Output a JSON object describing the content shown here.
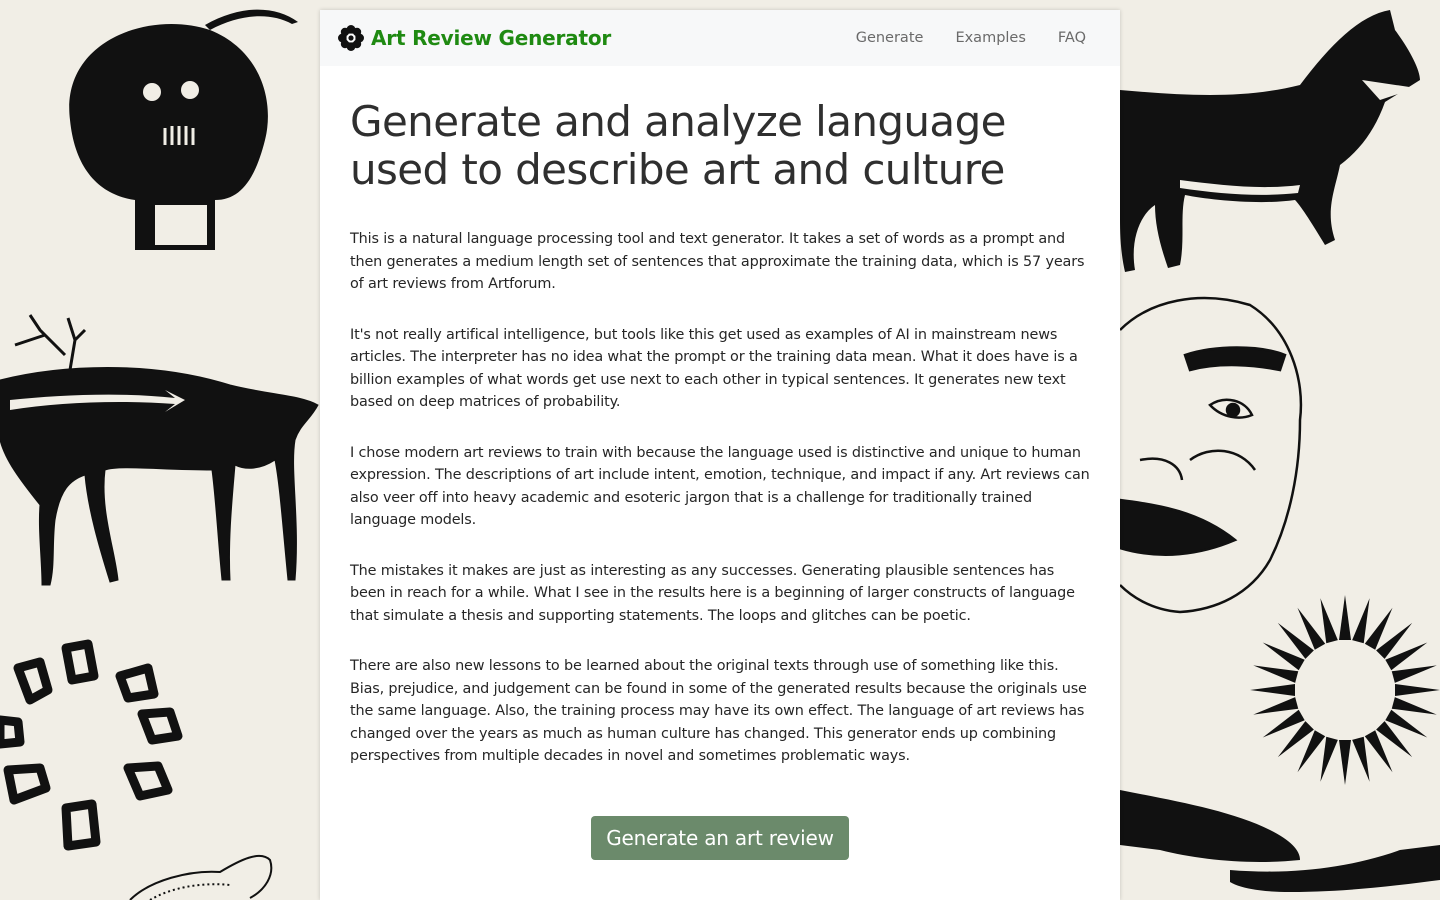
{
  "brand": {
    "title": "Art Review Generator",
    "logo_icon": "flower-logo-icon",
    "color": "#1f8a12"
  },
  "nav": {
    "items": [
      {
        "label": "Generate"
      },
      {
        "label": "Examples"
      },
      {
        "label": "FAQ"
      }
    ]
  },
  "main": {
    "heading": "Generate and analyze language used to describe art and culture",
    "paragraphs": [
      "This is a natural language processing tool and text generator. It takes a set of words as a prompt and then generates a medium length set of sentences that approximate the training data, which is 57 years of art reviews from Artforum.",
      "It's not really artifical intelligence, but tools like this get used as examples of AI in mainstream news articles. The interpreter has no idea what the prompt or the training data mean. What it does have is a billion examples of what words get use next to each other in typical sentences. It generates new text based on deep matrices of probability.",
      "I chose modern art reviews to train with because the language used is distinctive and unique to human expression. The descriptions of art include intent, emotion, technique, and impact if any. Art reviews can also veer off into heavy academic and esoteric jargon that is a challenge for traditionally trained language models.",
      "The mistakes it makes are just as interesting as any successes. Generating plausible sentences has been in reach for a while. What I see in the results here is a beginning of larger constructs of language that simulate a thesis and supporting statements. The loops and glitches can be poetic.",
      "There are also new lessons to be learned about the original texts through use of something like this. Bias, prejudice, and judgement can be found in some of the generated results because the originals use the same language. Also, the training process may have its own effect. The language of art reviews has changed over the years as much as human culture has changed. This generator ends up combining perspectives from multiple decades in novel and sometimes problematic ways."
    ],
    "cta_label": "Generate an art review",
    "cta_color": "#6b8a6b"
  },
  "background": {
    "icons": [
      "skull-drawing-icon",
      "wolf-drawing-icon",
      "deer-drawing-icon",
      "mask-drawing-icon",
      "diamond-ring-drawing-icon",
      "sunburst-drawing-icon",
      "fish-drawing-icon",
      "snake-drawing-icon"
    ],
    "color": "#f1eee6"
  }
}
